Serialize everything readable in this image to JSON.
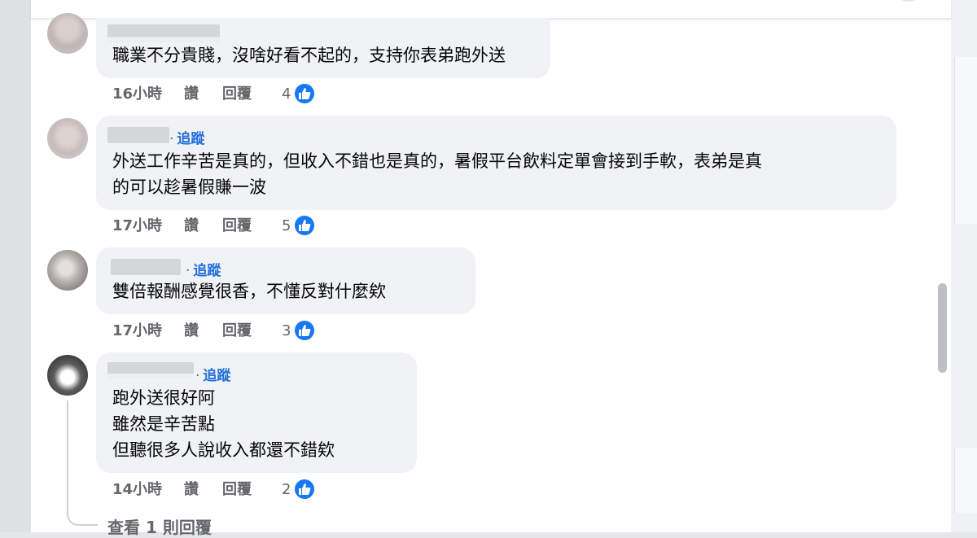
{
  "comments": [
    {
      "follow_label": "",
      "lines": [
        "職業不分貴賤，沒啥好看不起的，支持你表弟跑外送"
      ],
      "time": "16小時",
      "like_label": "讚",
      "reply_label": "回覆",
      "reaction_count": "4"
    },
    {
      "follow_label": "追蹤",
      "lines": [
        "外送工作辛苦是真的，但收入不錯也是真的，暑假平台飲料定單會接到手軟，表弟是真",
        "的可以趁暑假賺一波"
      ],
      "time": "17小時",
      "like_label": "讚",
      "reply_label": "回覆",
      "reaction_count": "5"
    },
    {
      "follow_label": "追蹤",
      "lines": [
        "雙倍報酬感覺很香，不懂反對什麼欸"
      ],
      "time": "17小時",
      "like_label": "讚",
      "reply_label": "回覆",
      "reaction_count": "3"
    },
    {
      "follow_label": "追蹤",
      "lines": [
        "跑外送很好阿",
        "雖然是辛苦點",
        "但聽很多人說收入都還不錯欸"
      ],
      "time": "14小時",
      "like_label": "讚",
      "reply_label": "回覆",
      "reaction_count": "2"
    }
  ],
  "view_replies_label": "查看 1 則回覆",
  "colors": {
    "bubble": "#f0f2f5",
    "follow": "#216fdb",
    "meta": "#65676b",
    "like": "#1877f2"
  },
  "icons": {
    "reaction": "like-thumb-icon"
  }
}
